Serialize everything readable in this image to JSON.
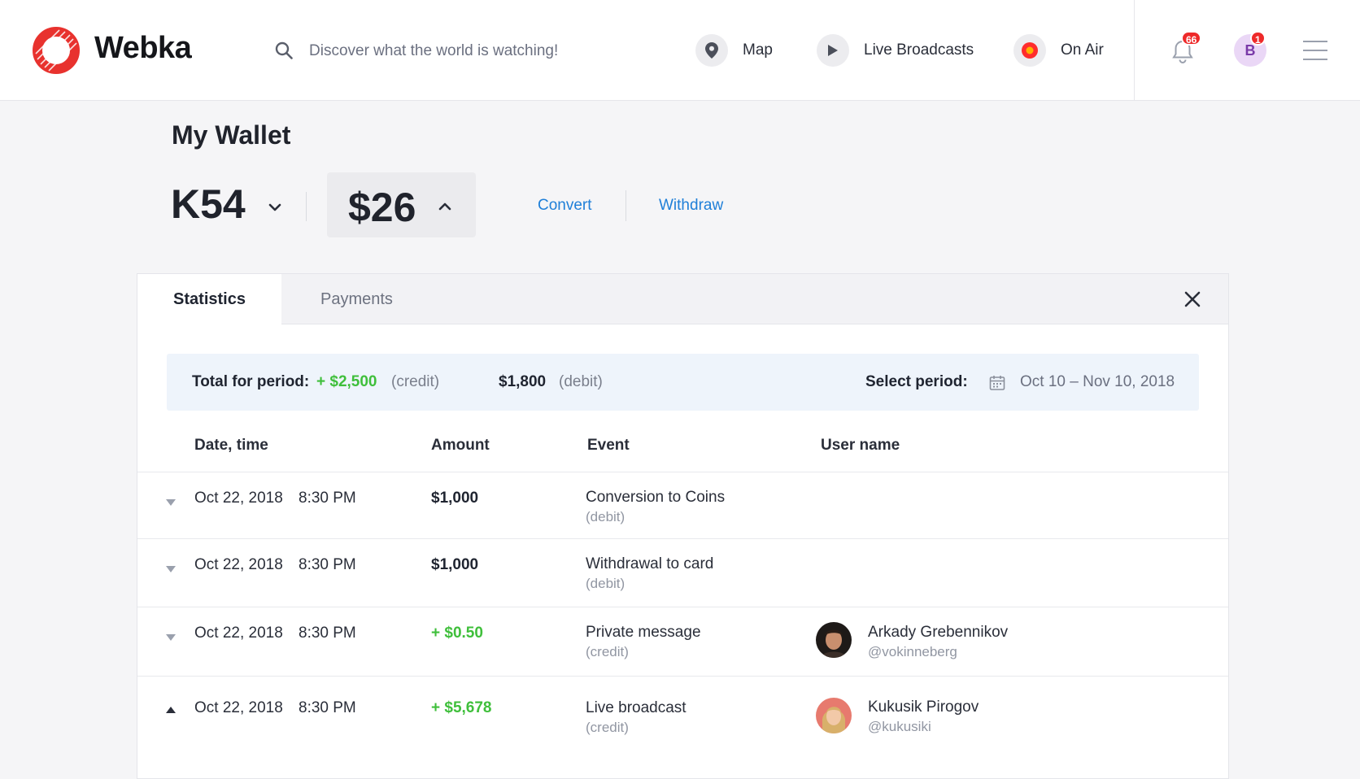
{
  "app": {
    "brand": "Webka",
    "colors": {
      "accent": "#1f7fd8",
      "credit": "#3fbf3b",
      "badge": "#ee2a2a",
      "logo": "#e8322e"
    }
  },
  "header": {
    "search": {
      "placeholder": "Discover what the world is watching!"
    },
    "nav": [
      {
        "label": "Map",
        "icon": "map-pin-icon"
      },
      {
        "label": "Live Broadcasts",
        "icon": "play-icon"
      },
      {
        "label": "On Air",
        "icon": "on-air-icon"
      }
    ],
    "notifications_count": "66",
    "avatar_initial": "B",
    "avatar_badge": "1"
  },
  "wallet": {
    "title": "My Wallet",
    "coins_balance": "K54",
    "usd_balance": "$26",
    "actions": {
      "convert": "Convert",
      "withdraw": "Withdraw"
    }
  },
  "panel": {
    "tabs": {
      "statistics": "Statistics",
      "payments": "Payments"
    },
    "summary": {
      "total_label": "Total for period:",
      "credit_amount": "+ $2,500",
      "credit_tag": "(credit)",
      "debit_amount": "$1,800",
      "debit_tag": "(debit)",
      "period_label": "Select period:",
      "period_value": "Oct 10 – Nov 10, 2018"
    },
    "columns": {
      "date": "Date, time",
      "amount": "Amount",
      "event": "Event",
      "user": "User name"
    },
    "rows": [
      {
        "date": "Oct 22, 2018",
        "time": "8:30 PM",
        "amount": "$1,000",
        "event": "Conversion to Coins",
        "type": "(debit)",
        "user_name": "",
        "user_handle": ""
      },
      {
        "date": "Oct 22, 2018",
        "time": "8:30 PM",
        "amount": "$1,000",
        "event": "Withdrawal to card",
        "type": "(debit)",
        "user_name": "",
        "user_handle": ""
      },
      {
        "date": "Oct 22, 2018",
        "time": "8:30 PM",
        "amount": "+ $0.50",
        "event": "Private message",
        "type": "(credit)",
        "user_name": "Arkady Grebennikov",
        "user_handle": "@vokinneberg"
      },
      {
        "date": "Oct 22, 2018",
        "time": "8:30 PM",
        "amount": "+ $5,678",
        "event": "Live broadcast",
        "type": "(credit)",
        "user_name": "Kukusik Pirogov",
        "user_handle": "@kukusiki"
      }
    ]
  }
}
